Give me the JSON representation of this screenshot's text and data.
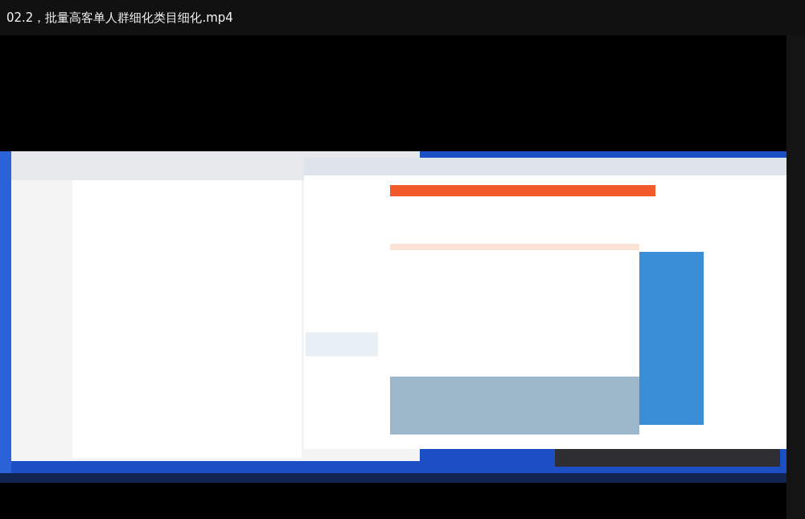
{
  "window": {
    "title": "02.2，批量高客单人群细化类目细化.mp4"
  }
}
